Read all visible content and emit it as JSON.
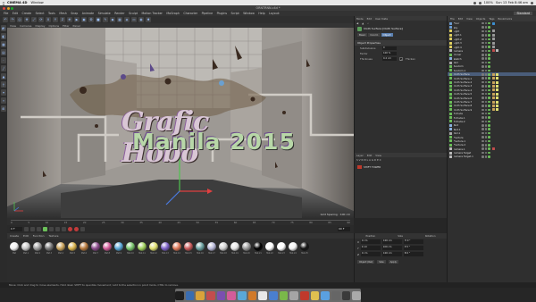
{
  "menubar": {
    "app": "CINEMA 4D",
    "items": [
      "Window"
    ],
    "right": {
      "battery": "100%",
      "clock": "Sun 13 Feb  8:46 am"
    }
  },
  "window": {
    "title": "ORNTRNN.c4d *"
  },
  "appmenu": {
    "items": [
      "File",
      "Edit",
      "Create",
      "Select",
      "Tools",
      "Mesh",
      "Snap",
      "Animate",
      "Simulate",
      "Render",
      "Sculpt",
      "Motion Tracker",
      "MoGraph",
      "Character",
      "Pipeline",
      "Plugins",
      "Script",
      "Window",
      "Help"
    ],
    "layout_label": "Layout:",
    "layout_value": "Standard"
  },
  "viewport": {
    "menu": [
      "View",
      "Cameras",
      "Display",
      "Options",
      "Filter",
      "Panel"
    ],
    "title_main": "Grafic Hobo",
    "title_sub": "Manila 2015",
    "grid_spacing": "Grid Spacing : 100 cm"
  },
  "timeline": {
    "ticks": [
      "0",
      "5",
      "10",
      "15",
      "20",
      "25",
      "30",
      "35",
      "40",
      "45",
      "50",
      "55",
      "60",
      "65",
      "70",
      "75",
      "80",
      "85",
      "90"
    ],
    "frame_start": "0 F",
    "frame_end": "90 F"
  },
  "materials": {
    "menu": [
      "Create",
      "Edit",
      "Function",
      "Texture"
    ],
    "items": [
      {
        "label": "Mat",
        "color": "#f0f0f0"
      },
      {
        "label": "Mat.1",
        "color": "#c8c8c8"
      },
      {
        "label": "Mat.2",
        "color": "#9c9c9c"
      },
      {
        "label": "Mat.3",
        "color": "#7a7a7a"
      },
      {
        "label": "Mat.4",
        "color": "#c9a35b"
      },
      {
        "label": "Mat.5",
        "color": "#d8b24c"
      },
      {
        "label": "Mat.6",
        "color": "#b77a3e"
      },
      {
        "label": "Mat.7",
        "color": "#8b4b8c"
      },
      {
        "label": "Mat.8",
        "color": "#d35c9a"
      },
      {
        "label": "Mat.9",
        "color": "#5aa8d8"
      },
      {
        "label": "Mat.10",
        "color": "#78c46c"
      },
      {
        "label": "Mat.11",
        "color": "#a0d05c"
      },
      {
        "label": "Mat.12",
        "color": "#e0e070"
      },
      {
        "label": "Mat.13",
        "color": "#7e62c8"
      },
      {
        "label": "Mat.14",
        "color": "#e07a5a"
      },
      {
        "label": "Mat.15",
        "color": "#c85a5a"
      },
      {
        "label": "Mat.16",
        "color": "#6aa0a0"
      },
      {
        "label": "Mat.17",
        "color": "#b8b8d8"
      },
      {
        "label": "Mat.18",
        "color": "#d0d0d0"
      },
      {
        "label": "Mat.19",
        "color": "#e6e6e6"
      },
      {
        "label": "Mat.20",
        "color": "#9a9a9a"
      },
      {
        "label": "Mat.21",
        "color": "#000000"
      },
      {
        "label": "Mat.22",
        "color": "#ffffff"
      },
      {
        "label": "Mat.23",
        "color": "#ffffff"
      },
      {
        "label": "Mat.24",
        "color": "#f2f2f2"
      },
      {
        "label": "Mat.25",
        "color": "#151515"
      }
    ]
  },
  "status": "Move: Click and drag to move elements. Hold down SHIFT to quantize movement / add to the selection in point mode, CTRL to remove.",
  "attributes": {
    "header": [
      "Mode",
      "Edit",
      "User Data"
    ],
    "object_label": "Cloth Surface [Cloth Surface]",
    "tabs": [
      "Basic",
      "Coord.",
      "Object"
    ],
    "section": "Object Properties",
    "rows": [
      {
        "label": "Subdivisions",
        "value": "0"
      },
      {
        "label": "Factor",
        "value": "100 %"
      },
      {
        "label": "Thickness",
        "value": "0.2 cm"
      }
    ],
    "checks": [
      {
        "label": "Thicken"
      }
    ]
  },
  "layers": {
    "header": [
      "Layer",
      "Edit",
      "View"
    ],
    "rows": [
      {
        "label": "SHIFT TOWER"
      }
    ]
  },
  "coords": {
    "head": [
      "Position",
      "Size",
      "Rotation"
    ],
    "rows": [
      {
        "axis": "X",
        "pos": "0 cm",
        "size": "100 cm",
        "rot": "H 0 °"
      },
      {
        "axis": "Y",
        "pos": "0 cm",
        "size": "100 cm",
        "rot": "P 0 °"
      },
      {
        "axis": "Z",
        "pos": "0 cm",
        "size": "100 cm",
        "rot": "B 0 °"
      }
    ],
    "foot": [
      "Object (Rel)",
      "Size",
      "Apply"
    ]
  },
  "objects": {
    "menu": [
      "File",
      "Edit",
      "View",
      "Objects",
      "Tags",
      "Bookmarks"
    ],
    "rows": [
      {
        "name": "Floor",
        "icon": "#6b9bd1",
        "tags": [
          "#3c8fd0"
        ]
      },
      {
        "name": "Sky",
        "icon": "#6b9bd1",
        "tags": []
      },
      {
        "name": "Light",
        "icon": "#e0d060",
        "tags": [
          "#999"
        ]
      },
      {
        "name": "Light.1",
        "icon": "#e0d060",
        "tags": [
          "#999"
        ]
      },
      {
        "name": "Light.2",
        "icon": "#e0d060",
        "tags": [
          "#999"
        ]
      },
      {
        "name": "Light.3",
        "icon": "#e0d060",
        "tags": [
          "#999"
        ]
      },
      {
        "name": "Light.4",
        "icon": "#e0d060",
        "tags": [
          "#999"
        ]
      },
      {
        "name": "Camera",
        "icon": "#bbbbbb",
        "tags": [
          "#c24d4d",
          "#bbb"
        ]
      },
      {
        "name": "Cloner",
        "icon": "#6bbf59",
        "tags": []
      },
      {
        "name": "Sketch",
        "icon": "#8ab3e0",
        "tags": []
      },
      {
        "name": "Null",
        "icon": "#aaaaaa",
        "tags": []
      },
      {
        "name": "Random",
        "icon": "#6bbf59",
        "tags": []
      },
      {
        "name": "Random.1",
        "icon": "#6bbf59",
        "tags": []
      },
      {
        "name": "Cloth Surface",
        "icon": "#6bbf59",
        "tags": [
          "#c9a35b",
          "#e0e070"
        ],
        "sel": true
      },
      {
        "name": "Cloth Surface.1",
        "icon": "#6bbf59",
        "tags": [
          "#c9a35b",
          "#e0e070"
        ]
      },
      {
        "name": "Cloth Surface.2",
        "icon": "#6bbf59",
        "tags": [
          "#c9a35b",
          "#e0e070"
        ]
      },
      {
        "name": "Cloth Surface.3",
        "icon": "#6bbf59",
        "tags": [
          "#c9a35b",
          "#e0e070"
        ]
      },
      {
        "name": "Cloth Surface.4",
        "icon": "#6bbf59",
        "tags": [
          "#c9a35b",
          "#e0e070"
        ]
      },
      {
        "name": "Cloth Surface.5",
        "icon": "#6bbf59",
        "tags": [
          "#c9a35b",
          "#e0e070"
        ]
      },
      {
        "name": "Cloth Surface.6",
        "icon": "#6bbf59",
        "tags": [
          "#c9a35b",
          "#e0e070"
        ]
      },
      {
        "name": "Cloth Surface.7",
        "icon": "#6bbf59",
        "tags": [
          "#c9a35b",
          "#e0e070"
        ]
      },
      {
        "name": "Cloth Surface.8",
        "icon": "#6bbf59",
        "tags": [
          "#c9a35b",
          "#e0e070"
        ]
      },
      {
        "name": "Cloth Surface.9",
        "icon": "#6bbf59",
        "tags": [
          "#c9a35b",
          "#e0e070"
        ]
      },
      {
        "name": "Extrude",
        "icon": "#6bbf59",
        "tags": []
      },
      {
        "name": "Extrude.1",
        "icon": "#6bbf59",
        "tags": []
      },
      {
        "name": "Extrude.2",
        "icon": "#6bbf59",
        "tags": []
      },
      {
        "name": "Text",
        "icon": "#8ab3e0",
        "tags": []
      },
      {
        "name": "Text.1",
        "icon": "#8ab3e0",
        "tags": []
      },
      {
        "name": "Null.1",
        "icon": "#aaaaaa",
        "tags": []
      },
      {
        "name": "Fracture",
        "icon": "#6bbf59",
        "tags": []
      },
      {
        "name": "Fracture.1",
        "icon": "#6bbf59",
        "tags": []
      },
      {
        "name": "Fracture.2",
        "icon": "#6bbf59",
        "tags": []
      },
      {
        "name": "Camera.1",
        "icon": "#bbbbbb",
        "tags": [
          "#c24d4d"
        ]
      },
      {
        "name": "Camera Target",
        "icon": "#bbbbbb",
        "tags": []
      },
      {
        "name": "Camera Target.1",
        "icon": "#bbbbbb",
        "tags": []
      }
    ]
  },
  "dock": [
    "#1e1e1e",
    "#3a6db0",
    "#d9a33a",
    "#c24d4d",
    "#7a4fb0",
    "#d35c9a",
    "#5aa8d8",
    "#d07a2a",
    "#e8e8e8",
    "#4a7fd0",
    "#7ab84a",
    "#a5a5a5",
    "#c0392b",
    "#e0c050",
    "#5aa0e0",
    "#666666",
    "#3a3a3a",
    "#aaaaaa"
  ]
}
